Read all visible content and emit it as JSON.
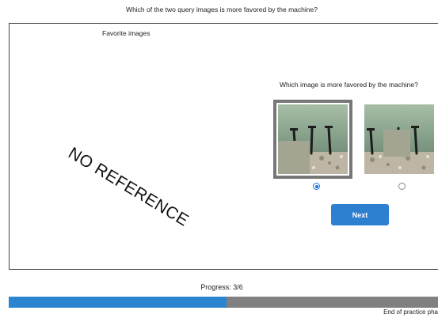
{
  "header": {
    "question": "Which of the two query images is more favored by the machine?"
  },
  "reference_panel": {
    "favorite_label": "Favorite images",
    "placeholder_text": "NO REFERENCE"
  },
  "choice_panel": {
    "question": "Which image is more favored by the machine?",
    "options": [
      {
        "image": "query-image-nails-with-gray-patch-bottom-left",
        "selected": true
      },
      {
        "image": "query-image-nails-with-gray-patch-center",
        "selected": false
      }
    ],
    "next_label": "Next"
  },
  "progress": {
    "label": "Progress: 3/6",
    "fraction": 0.5,
    "colors": {
      "fill": "#2b84d0",
      "track": "#808080"
    }
  },
  "footer": {
    "status": "End of practice pha"
  },
  "colors": {
    "accent": "#2d7fd0",
    "selected_border": "#777777"
  }
}
